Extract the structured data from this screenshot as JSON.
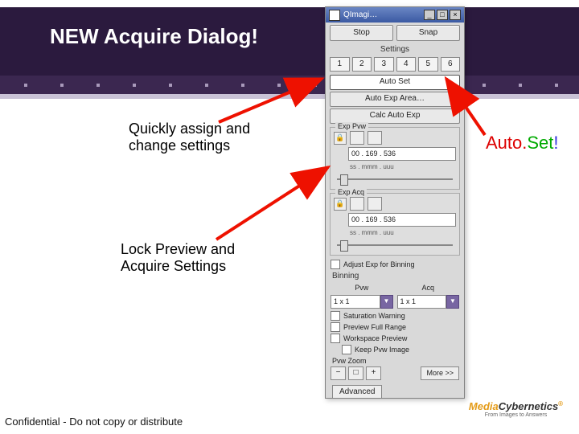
{
  "slide": {
    "title": "NEW Acquire Dialog!",
    "callout_settings": "Quickly assign and change settings",
    "callout_lock": "Lock Preview and Acquire Settings",
    "callout_autoset_1": "Auto.",
    "callout_autoset_2": "Set",
    "callout_autoset_3": "!",
    "footer": "Confidential - Do not copy or distribute",
    "logo_media": "Media",
    "logo_cyber": "Cybernetics",
    "logo_reg": "®",
    "logo_tag": "From Images to Answers"
  },
  "dialog": {
    "title": "QImagi…",
    "stop": "Stop",
    "snap": "Snap",
    "settings_label": "Settings",
    "preset_buttons": [
      "1",
      "2",
      "3",
      "4",
      "5",
      "6"
    ],
    "auto_set": "Auto Set",
    "auto_exp_area": "Auto Exp Area…",
    "calc_auto_exp": "Calc Auto Exp",
    "exp_pvw_label": "Exp Pvw",
    "exp_acq_label": "Exp Acq",
    "time_value": "00 . 169 . 536",
    "time_units": "ss . mmm . uuu",
    "adjust_exp": "Adjust Exp for Binning",
    "binning_label": "Binning",
    "pvw_label": "Pvw",
    "acq_label": "Acq",
    "bin_pvw": "1 x 1",
    "bin_acq": "1 x 1",
    "sat_warn": "Saturation Warning",
    "prev_full": "Preview Full Range",
    "workspace_prev": "Workspace Preview",
    "keep_pvw": "Keep Pvw Image",
    "pvw_zoom_label": "Pvw Zoom",
    "zoom_minus": "−",
    "zoom_fit": "□",
    "zoom_plus": "+",
    "more": "More >>",
    "advanced_tab": "Advanced"
  }
}
